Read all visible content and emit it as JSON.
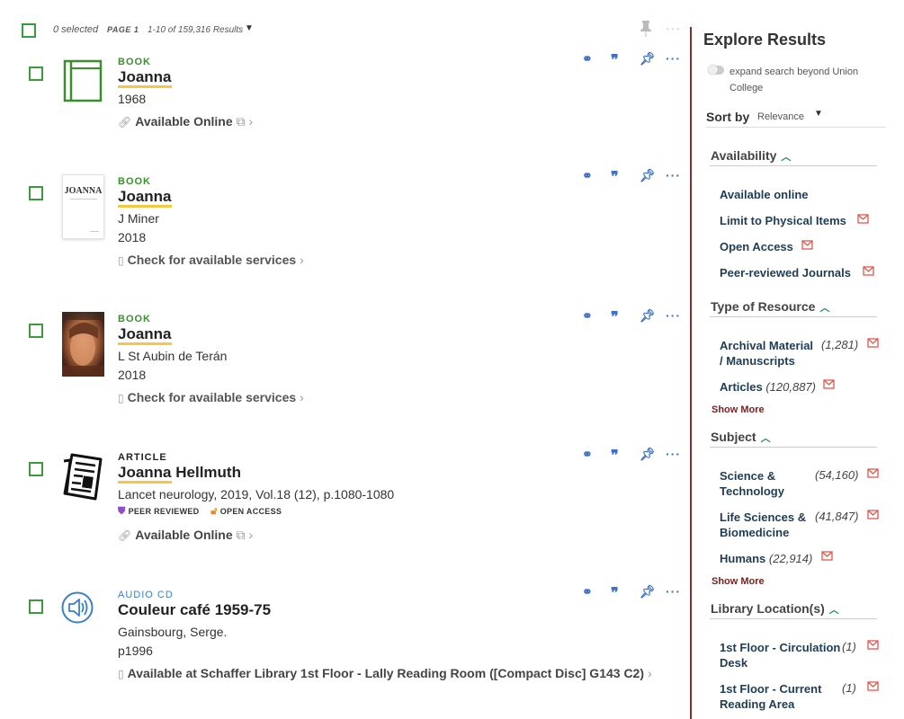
{
  "header": {
    "selected": "0 selected",
    "page": "PAGE 1",
    "results": "1-10 of 159,316 Results"
  },
  "results": [
    {
      "type": "BOOK",
      "title_hl": "Joanna",
      "title_rest": "",
      "lines": [
        "1968"
      ],
      "availability": "Available Online",
      "icon": "book-icon"
    },
    {
      "type": "BOOK",
      "title_hl": "Joanna",
      "title_rest": "",
      "lines": [
        "J Miner",
        "2018"
      ],
      "availability": "Check for available services",
      "thumb_text": "JOANNA",
      "icon": "cover-thumbnail"
    },
    {
      "type": "BOOK",
      "title_hl": "Joanna",
      "title_rest": "",
      "lines": [
        "L St Aubin de Terán",
        "2018"
      ],
      "availability": "Check for available services",
      "icon": "cover-thumbnail"
    },
    {
      "type": "ARTICLE",
      "title_hl": "Joanna",
      "title_rest": " Hellmuth",
      "lines": [
        "Lancet neurology, 2019, Vol.18 (12), p.1080-1080"
      ],
      "badges": {
        "peer": "PEER REVIEWED",
        "open": "OPEN ACCESS"
      },
      "availability": "Available Online",
      "icon": "article-icon"
    },
    {
      "type": "AUDIO CD",
      "title_hl": "",
      "title_rest": "Couleur café 1959-75",
      "lines": [
        "Gainsbourg, Serge.",
        "p1996"
      ],
      "availability": "Available at Schaffer Library  1st Floor - Lally Reading Room ([Compact Disc] G143 C2)",
      "icon": "audio-icon"
    }
  ],
  "sidebar": {
    "title": "Explore Results",
    "expand": "expand search beyond Union College",
    "sort_label": "Sort by",
    "sort_value": "Relevance",
    "availability": {
      "heading": "Availability",
      "items": [
        "Available online",
        "Limit to Physical Items",
        "Open Access",
        "Peer-reviewed Journals"
      ]
    },
    "resource": {
      "heading": "Type of Resource",
      "items": [
        {
          "label": "Archival Material / Manuscripts",
          "count": "(1,281)"
        },
        {
          "label": "Articles",
          "count": "(120,887)"
        }
      ],
      "show_more": "Show More"
    },
    "subject": {
      "heading": "Subject",
      "items": [
        {
          "label": "Science & Technology",
          "count": "(54,160)"
        },
        {
          "label": "Life Sciences & Biomedicine",
          "count": "(41,847)"
        },
        {
          "label": "Humans",
          "count": "(22,914)"
        }
      ],
      "show_more": "Show More"
    },
    "location": {
      "heading": "Library Location(s)",
      "items": [
        {
          "label": "1st Floor - Circulation Desk",
          "count": "(1)"
        },
        {
          "label": "1st Floor - Current Reading Area",
          "count": "(1)"
        }
      ]
    }
  },
  "colors": {
    "book": "#3b8e2e",
    "article": "#222222",
    "audio": "#3a80c8",
    "action": "#3a70c8",
    "highlight": "#f5c842",
    "exclude": "#e2574c"
  }
}
